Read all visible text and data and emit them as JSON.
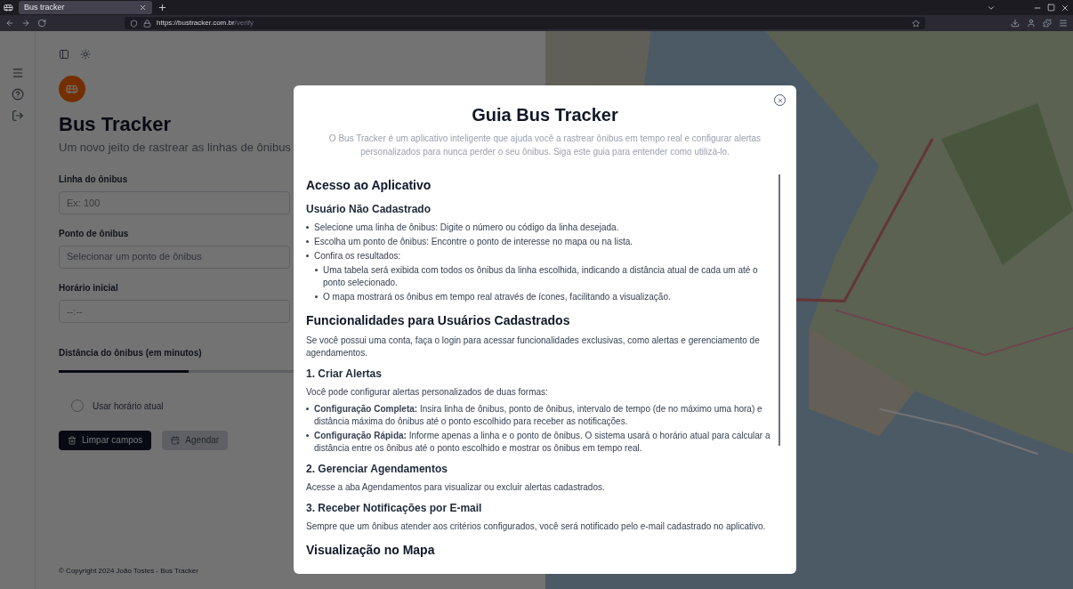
{
  "browser": {
    "tab_title": "Bus tracker",
    "url_host": "https://bustracker.com.br",
    "url_path": "/verify"
  },
  "app": {
    "title": "Bus Tracker",
    "subtitle": "Um novo jeito de rastrear as linhas de ônibus",
    "fields": [
      {
        "kind": "input",
        "label": "Linha do ônibus",
        "placeholder": "Ex: 100"
      },
      {
        "kind": "select",
        "label": "Ponto de ônibus",
        "placeholder": "Selecionar um ponto de ônibus"
      },
      {
        "kind": "input",
        "label": "Horário inicial",
        "placeholder": "--:--"
      }
    ],
    "slider": {
      "label": "Distância do ônibus (em minutos)",
      "level": 0.28
    },
    "checkbox": {
      "label": "Usar horário atual",
      "checked": false
    },
    "buttons": [
      {
        "label": "Limpar campos",
        "disabled": false
      },
      {
        "label": "Agendar",
        "disabled": true
      }
    ],
    "footer": "© Copyright 2024 João Tostes - Bus Tracker"
  },
  "modal": {
    "title": "Guia Bus Tracker",
    "intro": "O Bus Tracker é um aplicativo inteligente que ajuda você a rastrear ônibus em tempo real e configurar alertas personalizados para nunca perder o seu ônibus. Siga este guia para entender como utilizá-lo.",
    "blocks": [
      {
        "kind": "heading",
        "text": "Acesso ao Aplicativo"
      },
      {
        "kind": "subheading",
        "text": "Usuário Não Cadastrado"
      },
      {
        "kind": "list",
        "items": [
          {
            "text": "Selecione uma linha de ônibus: Digite o número ou código da linha desejada."
          },
          {
            "text": "Escolha um ponto de ônibus: Encontre o ponto de interesse no mapa ou na lista."
          },
          {
            "text": "Confira os resultados:",
            "children": [
              {
                "text": "Uma tabela será exibida com todos os ônibus da linha escolhida, indicando a distância atual de cada um até o ponto selecionado."
              },
              {
                "text": "O mapa mostrará os ônibus em tempo real através de ícones, facilitando a visualização."
              }
            ]
          }
        ]
      },
      {
        "kind": "heading",
        "text": "Funcionalidades para Usuários Cadastrados"
      },
      {
        "kind": "paragraph",
        "text": "Se você possui uma conta, faça o login para acessar funcionalidades exclusivas, como alertas e gerenciamento de agendamentos."
      },
      {
        "kind": "subheading",
        "text": "1. Criar Alertas"
      },
      {
        "kind": "paragraph",
        "text": "Você pode configurar alertas personalizados de duas formas:"
      },
      {
        "kind": "list",
        "items": [
          {
            "text": "**Configuração Completa:** Insira linha de ônibus, ponto de ônibus, intervalo de tempo (de no máximo uma hora) e distância máxima do ônibus até o ponto escolhido para receber as notificações."
          },
          {
            "text": "**Configuração Rápida:** Informe apenas a linha e o ponto de ônibus. O sistema usará o horário atual para calcular a distância entre os ônibus até o ponto escolhido e mostrar os ônibus em tempo real."
          }
        ]
      },
      {
        "kind": "subheading",
        "text": "2. Gerenciar Agendamentos"
      },
      {
        "kind": "paragraph",
        "text": "Acesse a aba Agendamentos para visualizar ou excluir alertas cadastrados."
      },
      {
        "kind": "subheading",
        "text": "3. Receber Notificações por E-mail"
      },
      {
        "kind": "paragraph",
        "text": "Sempre que um ônibus atender aos critérios configurados, você será notificado pelo e-mail cadastrado no aplicativo."
      },
      {
        "kind": "heading",
        "text": "Visualização no Mapa"
      }
    ]
  }
}
